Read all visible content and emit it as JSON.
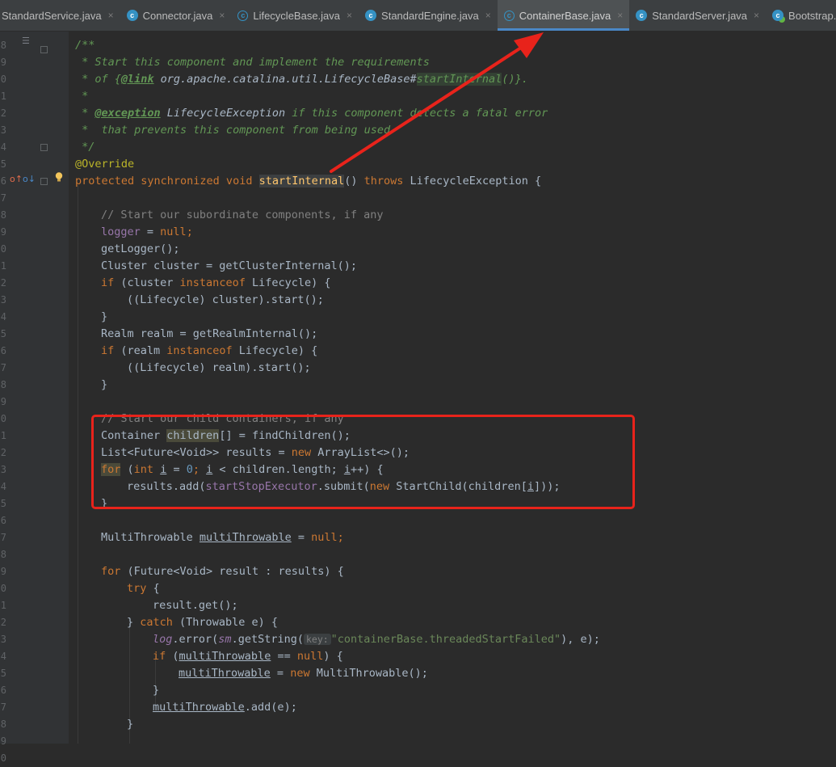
{
  "tabs": [
    {
      "label": "StandardService.java",
      "icon": "class-icon",
      "active": false
    },
    {
      "label": "Connector.java",
      "icon": "class-icon",
      "active": false
    },
    {
      "label": "LifecycleBase.java",
      "icon": "abstract-class-icon",
      "active": false
    },
    {
      "label": "StandardEngine.java",
      "icon": "class-icon",
      "active": false
    },
    {
      "label": "ContainerBase.java",
      "icon": "abstract-class-icon",
      "active": true
    },
    {
      "label": "StandardServer.java",
      "icon": "class-icon",
      "active": false
    },
    {
      "label": "Bootstrap.java",
      "icon": "runnable-class-icon",
      "active": false
    }
  ],
  "close_glyph": "×",
  "gutter": {
    "line_number_digits": [
      "8",
      "9",
      "0",
      "1",
      "2",
      "3",
      "4",
      "5",
      "6",
      "7",
      "8",
      "9",
      "0",
      "1",
      "2",
      "3",
      "4",
      "5",
      "6",
      "7",
      "8",
      "9",
      "0",
      "1",
      "2",
      "3",
      "4",
      "5",
      "6",
      "7",
      "8",
      "9",
      "0",
      "1",
      "2",
      "3",
      "4",
      "5",
      "6",
      "7",
      "8",
      "9",
      "0"
    ],
    "current_line_digit": "6"
  },
  "code_text": {
    "doc_open": "/**",
    "doc_l1": " * Start this component and implement the requirements",
    "doc_l2a": " * of {",
    "doc_l2link": "@link",
    "doc_l2ref": " org.apache.catalina.util.LifecycleBase#",
    "doc_l2method": "startInternal",
    "doc_l2b": "()}.",
    "doc_star": " *",
    "doc_l4a": " * ",
    "doc_l4tag": "@exception",
    "doc_l4ref": " LifecycleException",
    "doc_l4b": " if this component detects a fatal error",
    "doc_l5": " *  that prevents this component from being used",
    "doc_close": " */",
    "annotation": "@Override",
    "sig_kw": "protected synchronized void ",
    "sig_fn": "startInternal",
    "sig_mid": "() ",
    "sig_throws": "throws",
    "sig_end": " LifecycleException {",
    "c1": "// Start our subordinate components, if any",
    "logger": "logger",
    "eq": " = ",
    "null": "null",
    "semi": ";",
    "get_logger": "getLogger();",
    "cluster_decl": "Cluster cluster = getClusterInternal();",
    "if_kw": "if",
    "if_cluster_a": " (cluster ",
    "instanceof": "instanceof",
    "if_cluster_b": " Lifecycle) {",
    "cluster_start": "((Lifecycle) cluster).start();",
    "rbrace": "}",
    "realm_decl": "Realm realm = getRealmInternal();",
    "if_realm_a": " (realm ",
    "realm_start": "((Lifecycle) realm).start();",
    "c2": "// Start our child containers, if any",
    "container_a": "Container ",
    "children": "children",
    "container_b": "[] = findChildren();",
    "list_a": "List<Future<Void>> results = ",
    "new_kw": "new",
    "list_b": " ArrayList<>();",
    "for_kw": "for",
    "for_a": " (",
    "int_kw": "int",
    "i_var": "i",
    "zero": "0",
    "for_lt": " < children.length; ",
    "for_pp": "++) {",
    "submit_a": "results.add(",
    "executor": "startStopExecutor",
    "submit_b": ".submit(",
    "submit_c": " StartChild(children[",
    "submit_d": "]));",
    "mt_type": "MultiThrowable ",
    "mt_var": "multiThrowable",
    "for2_a": " (Future<Void> result : results) {",
    "try_kw": "try",
    "try_b": " {",
    "result_get": "result.get();",
    "catch_kw": "catch",
    "catch_b": " (Throwable e) {",
    "log": "log",
    "error_a": ".error(",
    "sm": "sm",
    "get_string": ".getString(",
    "key_hint": "key:",
    "key_str": "\"containerBase.threadedStartFailed\"",
    "error_b": "), e);",
    "if_mt_a": " (",
    "if_mt_b": " == ",
    "if_mt_c": ") {",
    "mt_new": " MultiThrowable();",
    "mt_add": ".add(e);"
  },
  "annotation_colors": {
    "highlight_box": "#e8231b",
    "arrow": "#e8231b"
  }
}
